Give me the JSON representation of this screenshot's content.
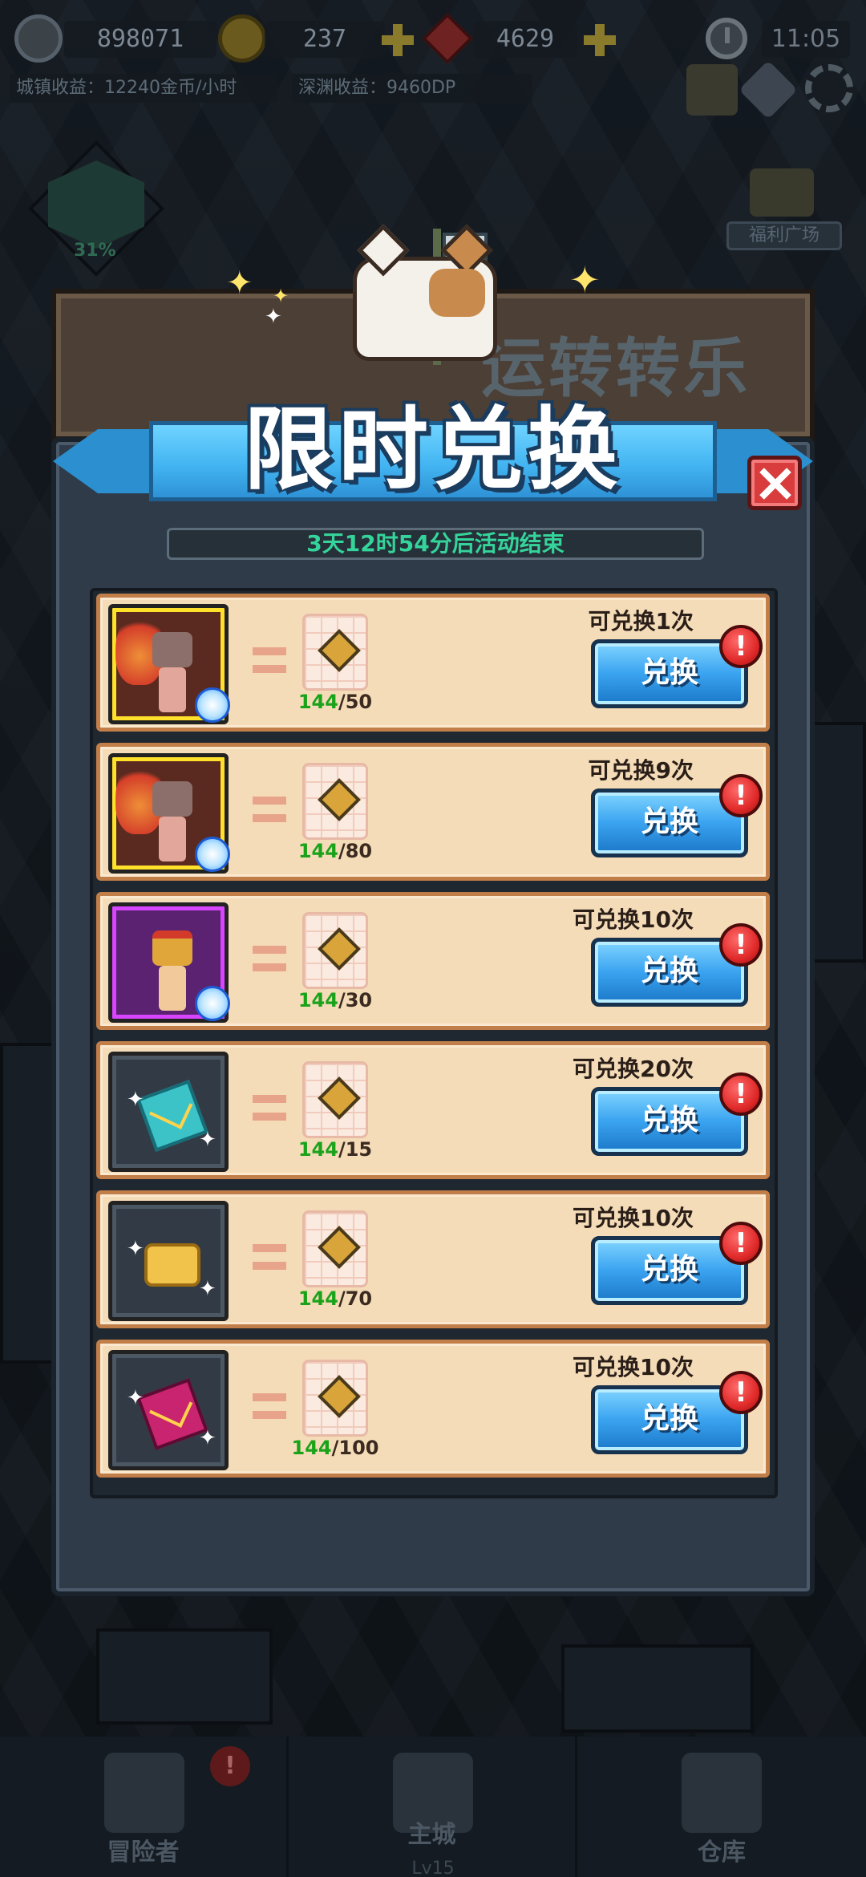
{
  "status_bar": {
    "power": "898071",
    "gold": "237",
    "gems": "4629",
    "time": "11:05",
    "town_income": "城镇收益：12240金币/小时",
    "abyss_income": "深渊收益：9460DP",
    "progress_percent": "31%",
    "welfare_label": "福利广场"
  },
  "modal": {
    "background_title": "运转转乐",
    "title": "限时兑换",
    "countdown": "3天12时54分后活动结束",
    "button_label": "兑换",
    "alert_mark": "!",
    "items": [
      {
        "reward": "hero-red",
        "limit": "可兑换1次",
        "have": "144",
        "need": "/50"
      },
      {
        "reward": "hero-red",
        "limit": "可兑换9次",
        "have": "144",
        "need": "/80"
      },
      {
        "reward": "hero-purple",
        "limit": "可兑换10次",
        "have": "144",
        "need": "/30"
      },
      {
        "reward": "teal-envelope-icon",
        "limit": "可兑换20次",
        "have": "144",
        "need": "/15"
      },
      {
        "reward": "gold-scroll-icon",
        "limit": "可兑换10次",
        "have": "144",
        "need": "/70"
      },
      {
        "reward": "pink-envelope-icon",
        "limit": "可兑换10次",
        "have": "144",
        "need": "/100"
      }
    ]
  },
  "bottom_nav": {
    "adventurer": "冒险者",
    "main_city": "主城",
    "main_city_level": "Lv15",
    "warehouse": "仓库",
    "alert": "!"
  },
  "colors": {
    "ribbon": "#43b5f2",
    "button": "#3aa3f0",
    "row_bg": "#f5dcb8",
    "countdown_text": "#35d49a",
    "have_count": "#1aa31a",
    "alert": "#e02a2a"
  }
}
